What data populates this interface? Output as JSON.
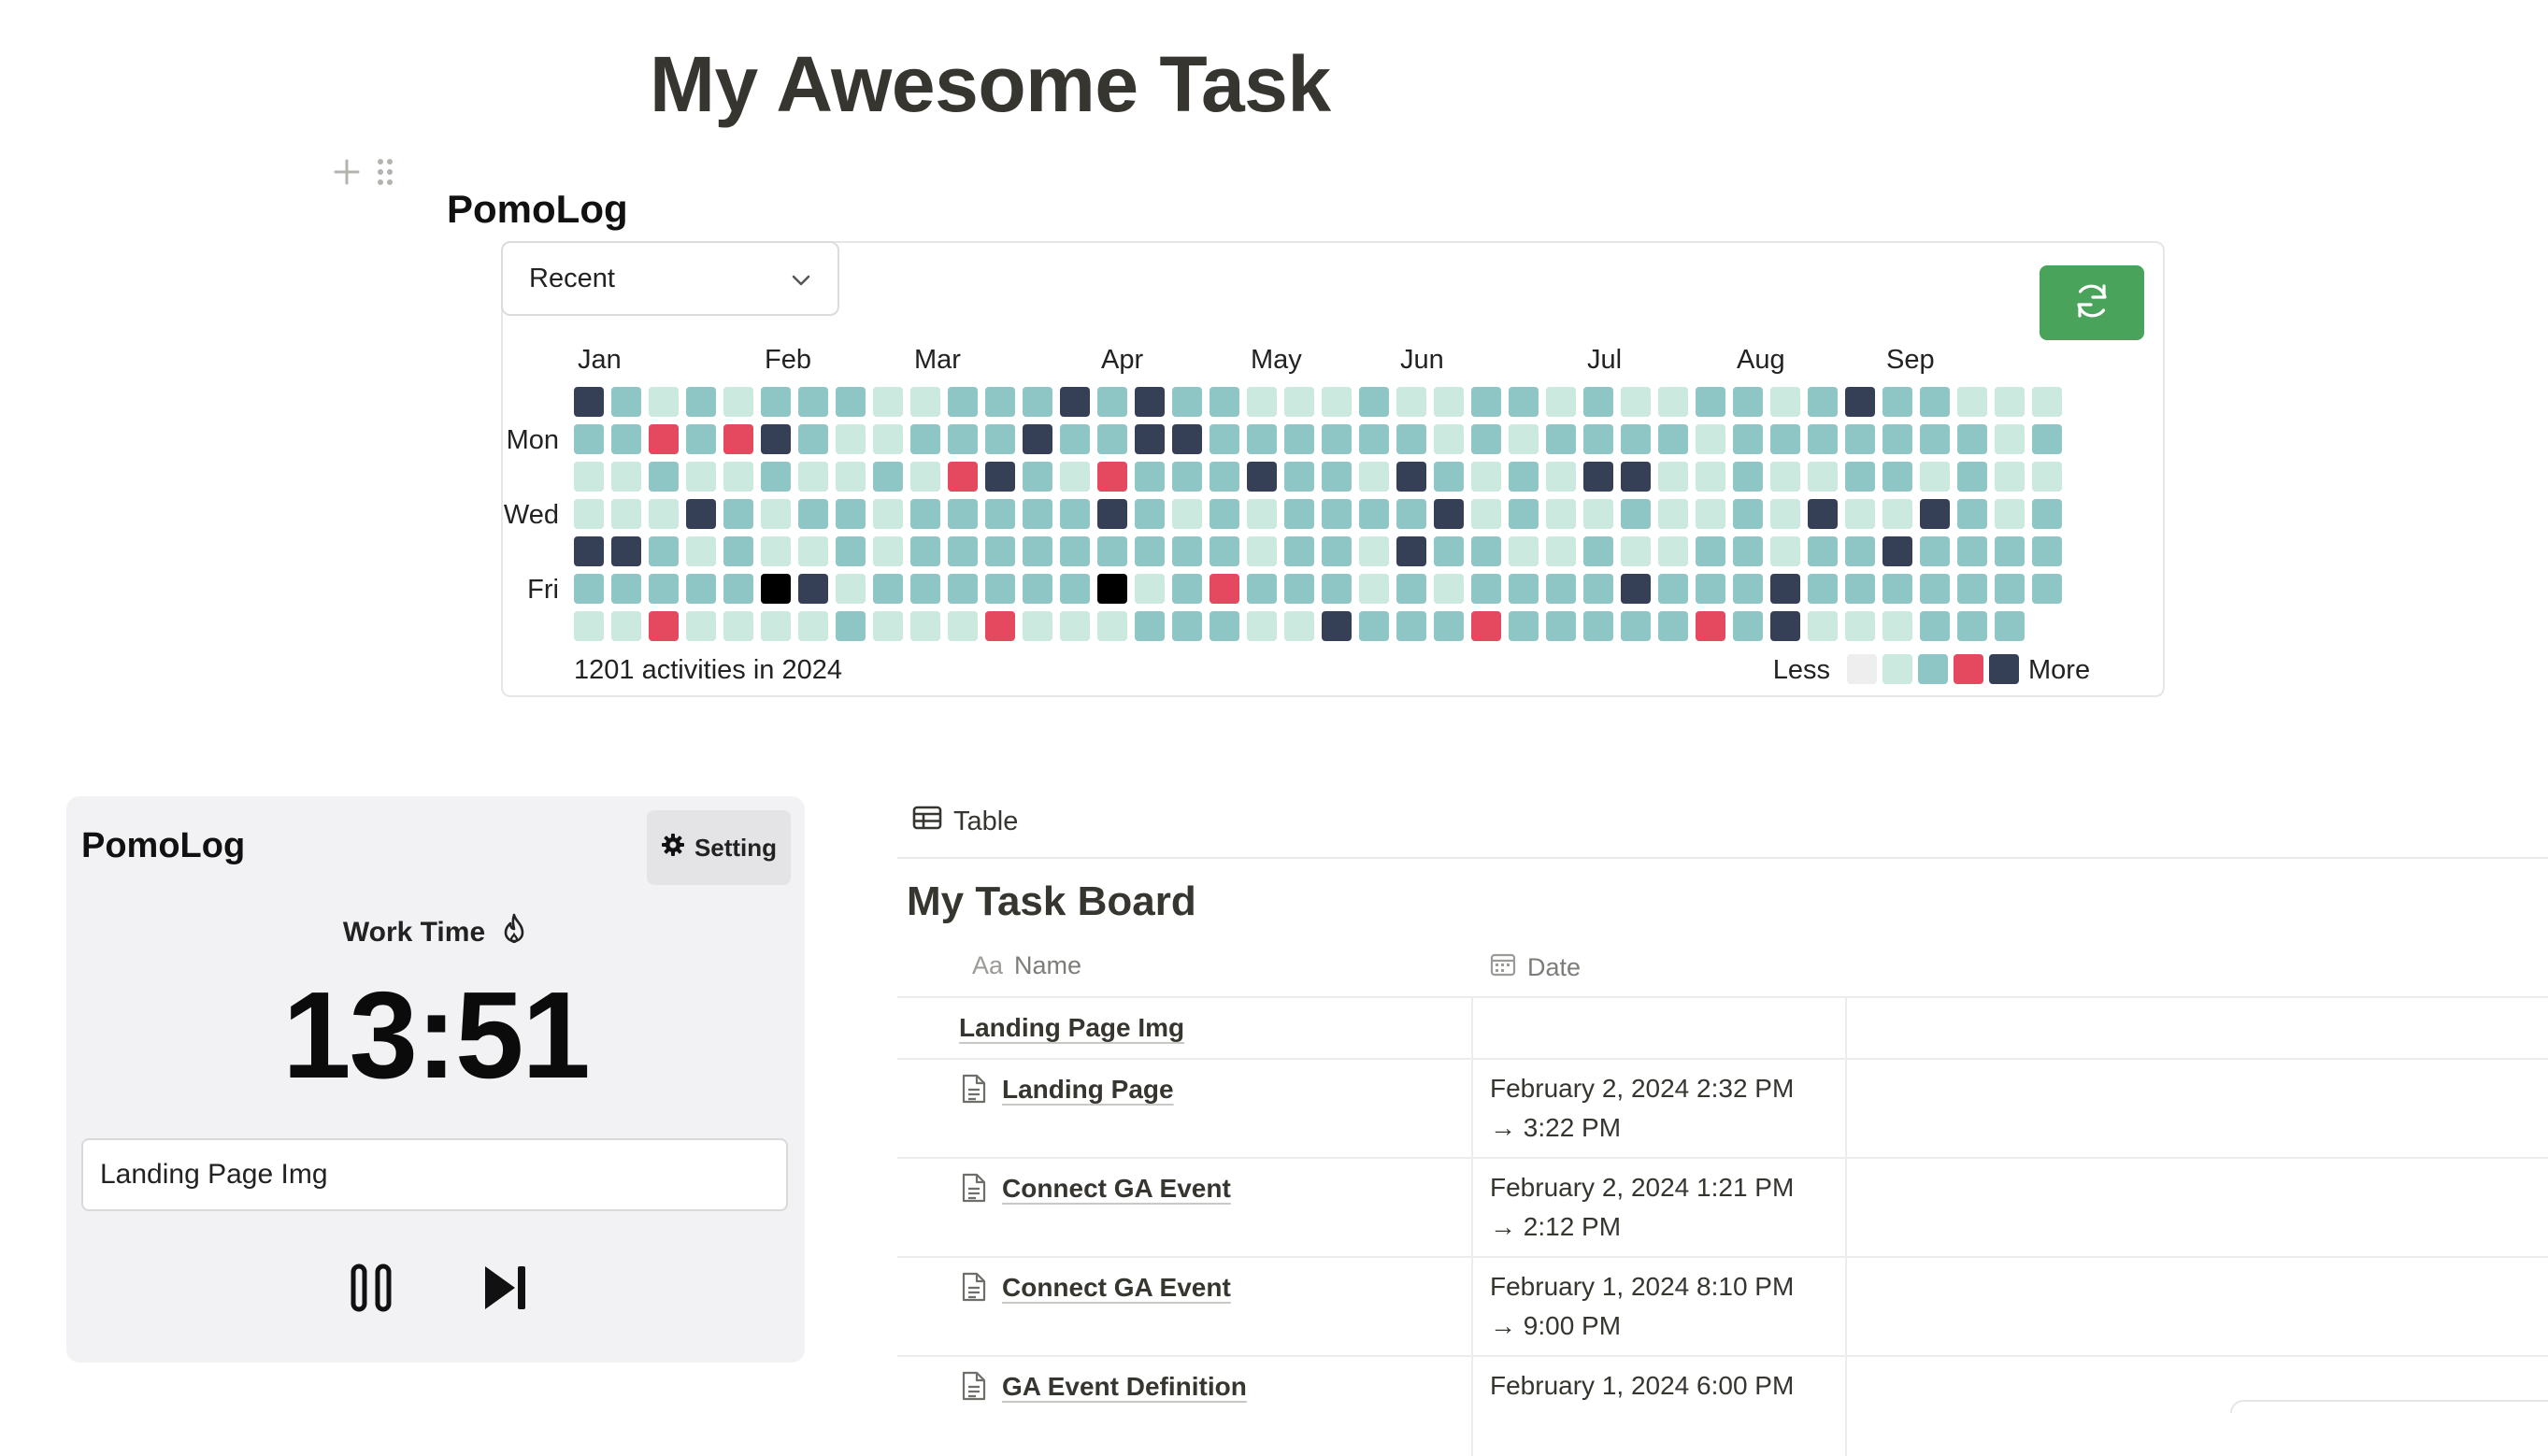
{
  "page": {
    "title": "My Awesome Task"
  },
  "pomolog_section": {
    "heading": "PomoLog"
  },
  "heatmap": {
    "range_select": {
      "value": "Recent"
    },
    "months": [
      "Jan",
      "Feb",
      "Mar",
      "Apr",
      "May",
      "Jun",
      "Jul",
      "Aug",
      "Sep"
    ],
    "month_week_index": [
      1,
      6,
      10,
      15,
      19,
      23,
      28,
      32,
      36
    ],
    "day_labels": {
      "mon": "Mon",
      "wed": "Wed",
      "fri": "Fri"
    },
    "summary": "1201 activities in 2024",
    "legend": {
      "less": "Less",
      "more": "More"
    },
    "level_colors": [
      "#eeeeee",
      "#cce9e0",
      "#8ec6c5",
      "#e4495f",
      "#353f55"
    ],
    "rows": [
      ".4212122211222424221112112212112212422111",
      ".2232342112224224422222212122221222222212",
      ".1121121121342132224221421214411211221211",
      ".1114212212222242121222241211211214114212",
      ".4421211212222222221221422112112212242222",
      ".2222254122222251232221212222422242222222",
      ".113111121113111222114222322222324111222"
    ]
  },
  "timer": {
    "title": "PomoLog",
    "setting_label": "Setting",
    "mode_label": "Work Time",
    "time": "13:51",
    "task_value": "Landing Page Img"
  },
  "board": {
    "view_label": "Table",
    "title": "My Task Board",
    "columns": {
      "name_prefix": "Aa",
      "name": "Name",
      "date": "Date"
    },
    "rows": [
      {
        "name": "Landing Page Img",
        "date_line1": "",
        "date_line2": "",
        "has_icon": false
      },
      {
        "name": "Landing Page",
        "date_line1": "February 2, 2024 2:32 PM",
        "date_line2": "→ 3:22 PM",
        "has_icon": true
      },
      {
        "name": "Connect GA Event",
        "date_line1": "February 2, 2024 1:21 PM",
        "date_line2": "→ 2:12 PM",
        "has_icon": true
      },
      {
        "name": "Connect GA Event",
        "date_line1": "February 1, 2024 8:10 PM",
        "date_line2": "→ 9:00 PM",
        "has_icon": true
      },
      {
        "name": "GA Event Definition",
        "date_line1": "February 1, 2024 6:00 PM",
        "date_line2": "",
        "has_icon": true
      }
    ]
  },
  "icons": {
    "add": "plus-icon",
    "drag": "drag-handle-icon",
    "dropdown": "chevron-down-icon",
    "refresh": "refresh-icon",
    "setting": "gear-icon",
    "work_time": "fire-icon",
    "pause": "pause-icon",
    "skip": "skip-next-icon",
    "table": "table-icon",
    "page": "page-icon",
    "date": "calendar-icon"
  }
}
